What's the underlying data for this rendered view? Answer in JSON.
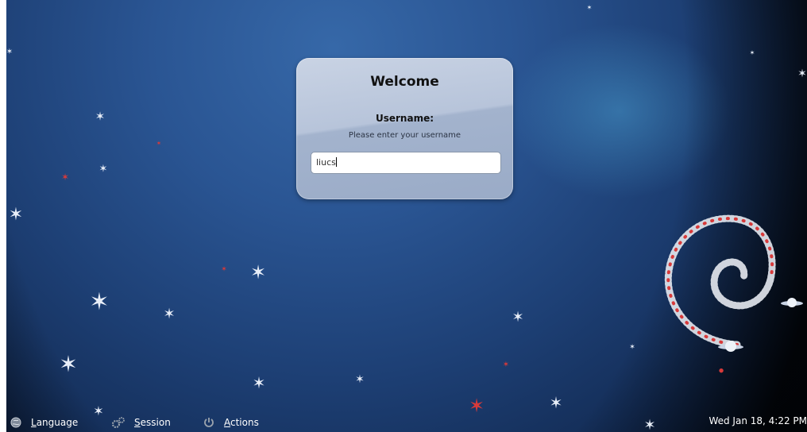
{
  "login": {
    "title": "Welcome",
    "username_label": "Username:",
    "hint": "Please enter your username",
    "username_value": "liucs"
  },
  "panel": {
    "language_label": "Language",
    "session_label": "Session",
    "actions_label": "Actions",
    "clock": "Wed Jan 18,  4:22 PM"
  },
  "icons": {
    "language": "globe-icon",
    "session": "gears-icon",
    "actions": "power-icon"
  },
  "colors": {
    "background_top": "#3668a8",
    "background_bottom": "#0a1a36",
    "dialog": "#b7c4da",
    "star_red": "#d83a3a"
  }
}
